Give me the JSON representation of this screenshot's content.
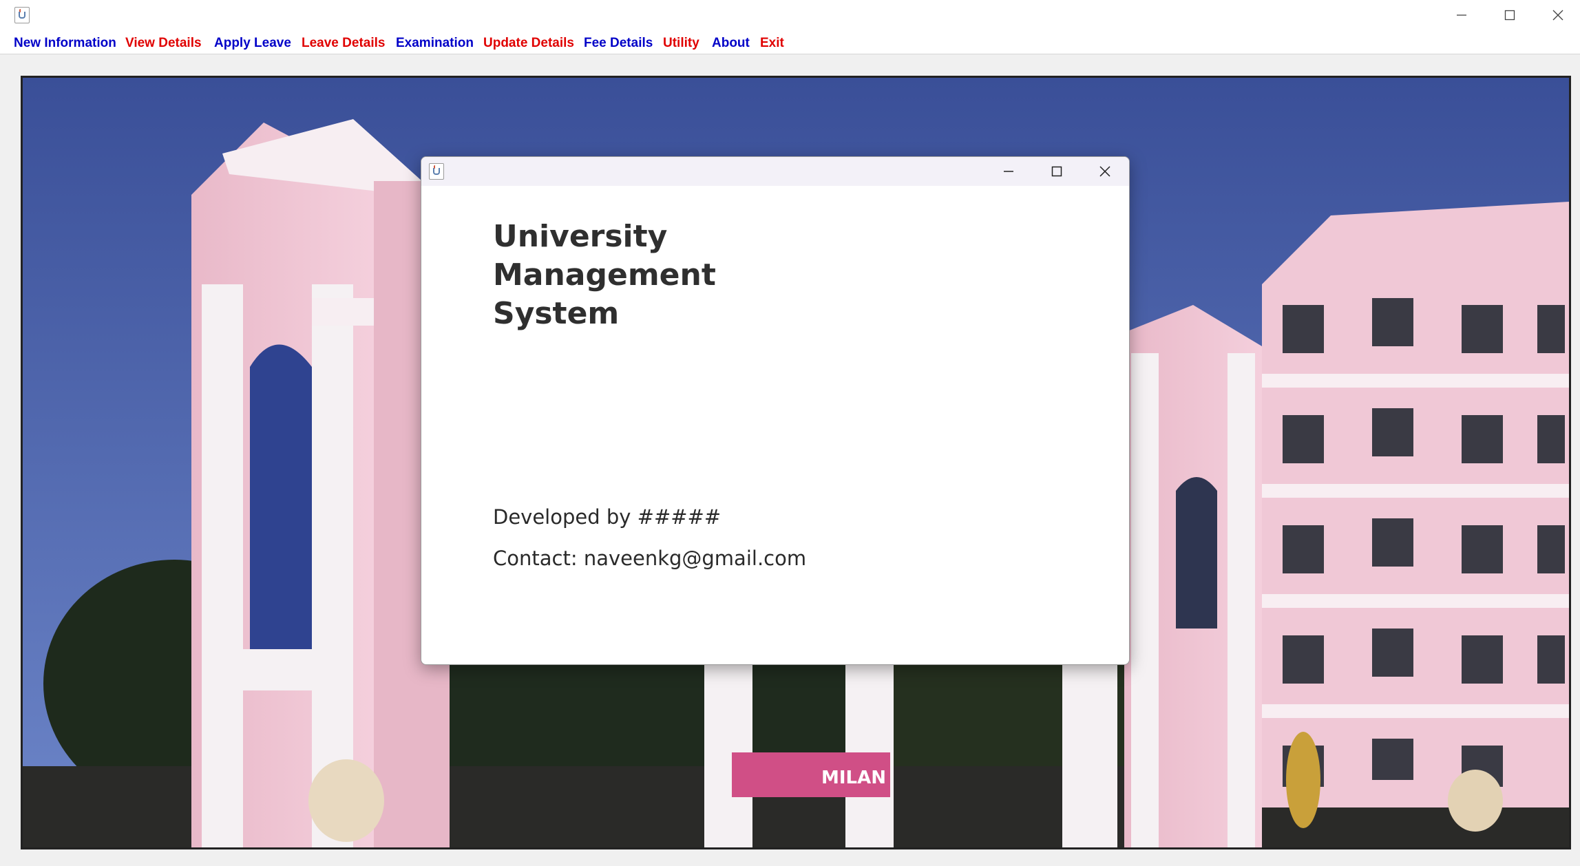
{
  "main_window": {
    "controls": {
      "minimize_icon": "minimize-icon",
      "maximize_icon": "maximize-icon",
      "close_icon": "close-icon"
    }
  },
  "menu": {
    "items": [
      {
        "label": "New Information",
        "color": "#0000c8"
      },
      {
        "label": "View Details",
        "color": "#e00000"
      },
      {
        "label": "Apply Leave",
        "color": "#0000c8"
      },
      {
        "label": "Leave Details",
        "color": "#e00000"
      },
      {
        "label": "Examination",
        "color": "#0000c8"
      },
      {
        "label": "Update Details",
        "color": "#e00000"
      },
      {
        "label": "Fee Details",
        "color": "#0000c8"
      },
      {
        "label": "Utility",
        "color": "#e00000"
      },
      {
        "label": "About",
        "color": "#0000c8"
      },
      {
        "label": "Exit",
        "color": "#e00000"
      }
    ]
  },
  "background": {
    "banner_text": "MILAN"
  },
  "dialog": {
    "title_lines": [
      "University",
      "Management",
      "System"
    ],
    "developed_by": "Developed by #####",
    "contact": "Contact: naveenkg@gmail.com"
  }
}
